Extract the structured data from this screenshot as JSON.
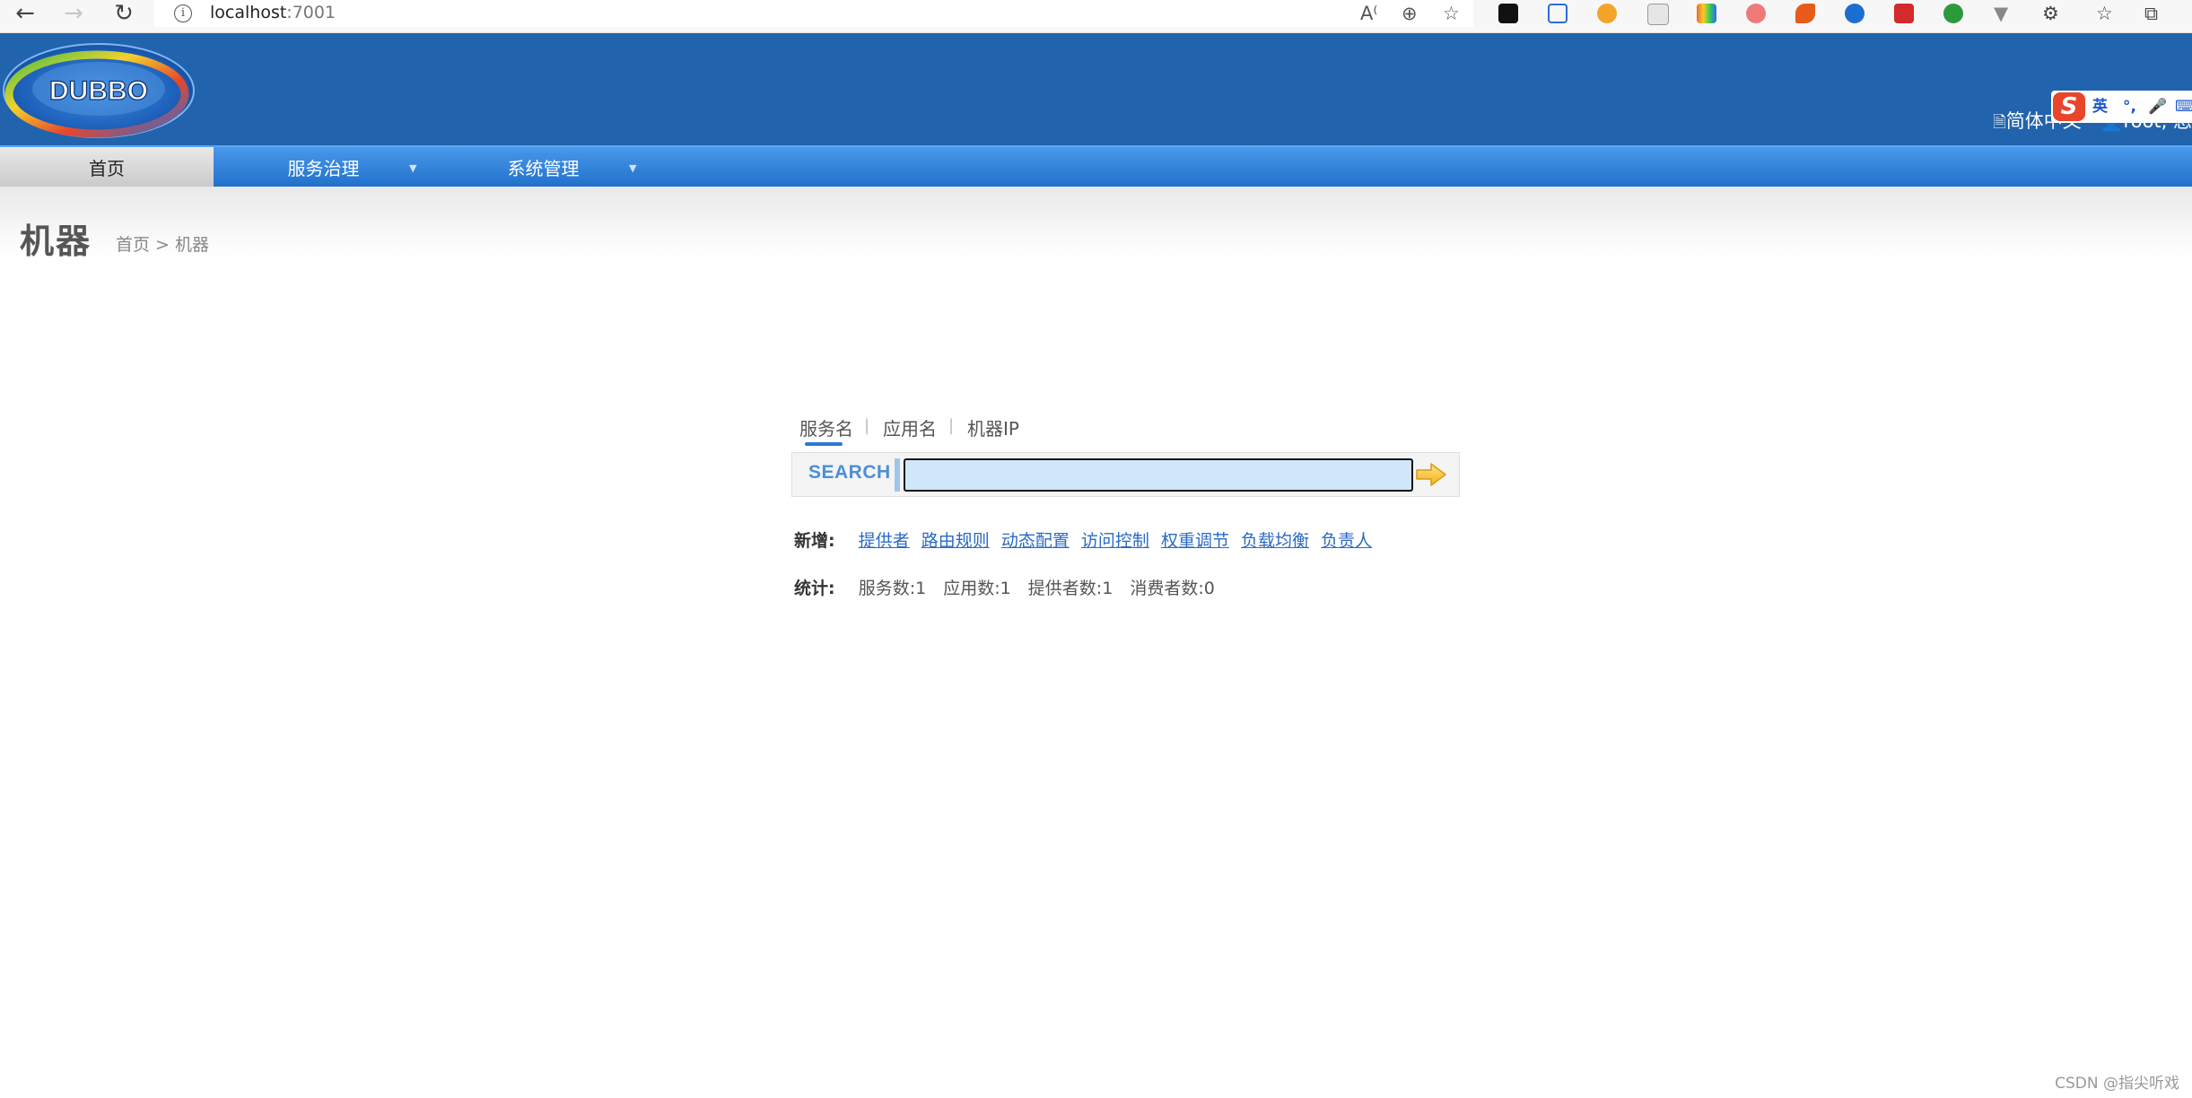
{
  "browser": {
    "url_host": "localhost",
    "url_port": ":7001"
  },
  "header": {
    "logo_text": "DUBBO",
    "language": "简体中文",
    "user": "root, 您"
  },
  "ime": {
    "logo": "S",
    "lang": "英",
    "punct": "°,"
  },
  "menu": {
    "items": [
      {
        "label": "首页"
      },
      {
        "label": "服务治理"
      },
      {
        "label": "系统管理"
      }
    ]
  },
  "page": {
    "title": "机器",
    "breadcrumb_home": "首页",
    "breadcrumb_sep": " > ",
    "breadcrumb_current": "机器"
  },
  "search": {
    "tabs": [
      {
        "label": "服务名"
      },
      {
        "label": "应用名"
      },
      {
        "label": "机器IP"
      }
    ],
    "tab_separator": "|",
    "label": "SEARCH",
    "value": ""
  },
  "add": {
    "label": "新增:",
    "links": [
      "提供者",
      "路由规则",
      "动态配置",
      "访问控制",
      "权重调节",
      "负载均衡",
      "负责人"
    ]
  },
  "stats": {
    "label": "统计:",
    "items": [
      "服务数:1",
      "应用数:1",
      "提供者数:1",
      "消费者数:0"
    ]
  },
  "watermark": "CSDN @指尖听戏",
  "colors": {
    "header_bg": "#2163ad",
    "menu_bg": "#2f80dc",
    "link": "#2a6ac4",
    "search_label": "#4b8fd6"
  }
}
